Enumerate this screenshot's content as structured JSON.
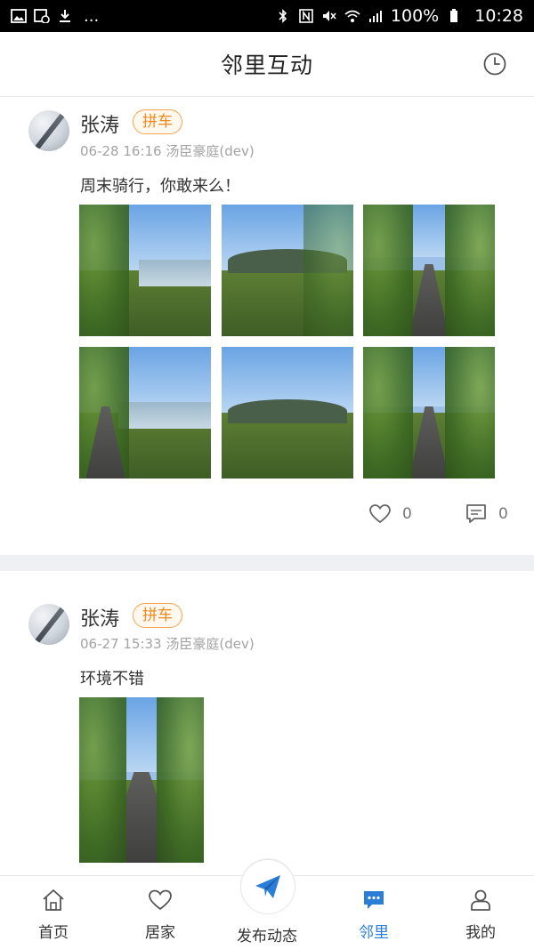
{
  "status_bar": {
    "dots": "...",
    "battery": "100%",
    "time": "10:28"
  },
  "header": {
    "title": "邻里互动"
  },
  "posts": [
    {
      "username": "张涛",
      "tag": "拼车",
      "meta": "06-28 16:16 汤臣豪庭(dev)",
      "text": "周末骑行，你敢来么！",
      "likes": "0",
      "comments": "0"
    },
    {
      "username": "张涛",
      "tag": "拼车",
      "meta": "06-27 15:33 汤臣豪庭(dev)",
      "text": "环境不错"
    }
  ],
  "nav": {
    "home": "首页",
    "living": "居家",
    "publish": "发布动态",
    "neighbors": "邻里",
    "mine": "我的"
  },
  "colors": {
    "accent_blue": "#2a7ed8",
    "tag_orange": "#f08a1c",
    "separator": "#eef0f3"
  },
  "icons": {
    "header_right": "clock-history-icon",
    "like": "heart-outline-icon",
    "comment": "comment-icon",
    "publish": "paper-plane-icon"
  }
}
